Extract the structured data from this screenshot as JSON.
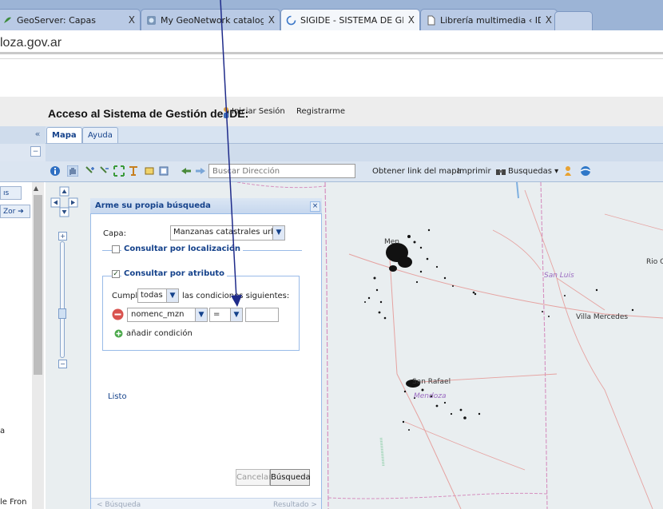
{
  "browser": {
    "tabs": [
      {
        "label": "GeoServer: Capas"
      },
      {
        "label": "My GeoNetwork catalogue"
      },
      {
        "label": "SIGIDE - SISTEMA DE GESTI("
      },
      {
        "label": "Librería multimedia ‹ IDEMEN"
      }
    ],
    "close_glyph": "X",
    "url": "loza.gov.ar"
  },
  "header": {
    "title": "Acceso al Sistema de Gestión de IDE:",
    "login": "Iniciar Sesión",
    "register": "Registrarme"
  },
  "apptabs": {
    "collapse": "«",
    "mapa": "Mapa",
    "ayuda": "Ayuda",
    "collapse2": "−"
  },
  "toolbar": {
    "search_placeholder": "Buscar Dirección",
    "link": "Obtener link del mapa",
    "print": "Imprimir",
    "searches": "Busquedas ▾"
  },
  "leftpanel": {
    "btn1": "ıs",
    "btn2": "Zor ➔",
    "text1": "a",
    "text2": "le Fron"
  },
  "map": {
    "labels": {
      "mendoza_city": "Men",
      "san_luis": "San Luis",
      "rio": "Rio C",
      "villa_mercedes": "Villa Mercedes",
      "san_rafael": "San Rafael",
      "mendoza_prov": "Mendoza"
    },
    "zoom_plus": "+",
    "zoom_minus": "−"
  },
  "dialog": {
    "title": "Arme su propia búsqueda",
    "close": "×",
    "capa_label": "Capa:",
    "capa_value": "Manzanas catastrales urbana",
    "loc_label": "Consultar por localización",
    "attr_label": "Consultar por atributo",
    "attr_check": "✓",
    "cumplir": "Cumplir",
    "todas": "todas",
    "condiciones": "las condiciones siguientes:",
    "field_value": "nomenc_mzn",
    "op_value": "=",
    "add_condition": "añadir condición",
    "status": "Listo",
    "cancel": "Cancelar",
    "search": "Búsqueda",
    "prev": "< Búsqueda",
    "next": "Resultado >"
  },
  "colors": {
    "ext_blue": "#15428b",
    "map_border": "#d58fbf",
    "map_bg": "#e9eef0",
    "arrow": "#1f2b8a"
  }
}
